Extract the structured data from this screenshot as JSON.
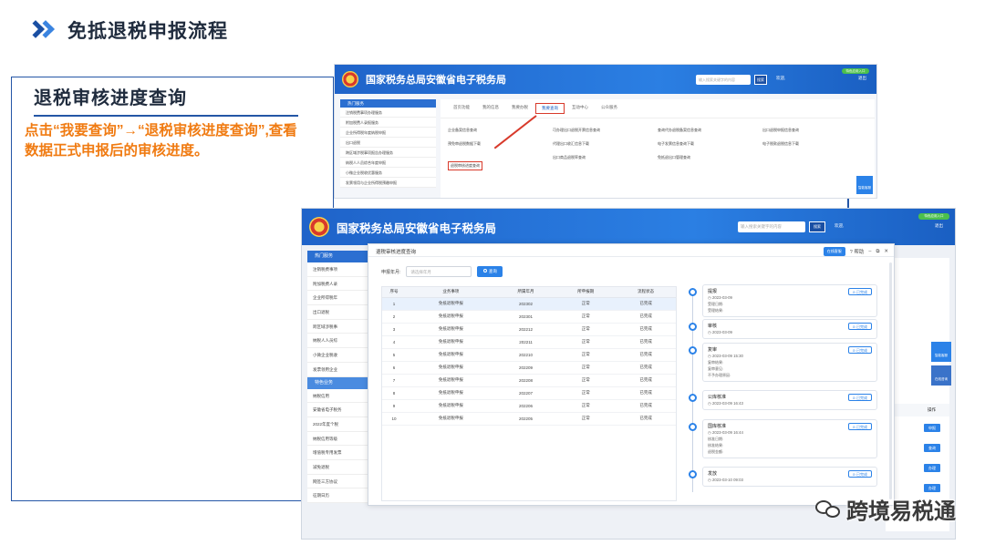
{
  "slide": {
    "title": "免抵退税申报流程",
    "left_title": "退税审核进度查询",
    "left_desc": "点击“我要查询”→“退税审核进度查询”,查看数据正式申报后的审核进度。"
  },
  "portal": {
    "brand": "国家税务总局安徽省电子税务局",
    "search_placeholder": "输入搜索关键字的内容",
    "search_button": "搜索",
    "user_label": "欢迎,",
    "logout": "退出",
    "green_badge": "特色应用入口",
    "sidebar_back": {
      "head": "热门服务",
      "items": [
        "注销税费事项办理服务",
        "附加税费人录报服务",
        "企业所得税年度纳税申报",
        "出口退税",
        "跨区域涉税事项报告办理服务",
        "纳税人人员综合年度申报",
        "小微企业税收优惠服务",
        "发票领用与企业所得税预缴申报"
      ]
    },
    "tabs": [
      "首页功能",
      "我的信息",
      "我要办税",
      "我要查询",
      "互动中心",
      "公众服务"
    ],
    "links": [
      "企业备案信息查询",
      "可办理出口退税开票信息查询",
      "查询代办退税备案信息查询",
      "出口退税申报信息查询",
      "预免审退税数据下载",
      "代理出口收汇信息下载",
      "电子发票信息查询下载",
      "电子税款退税信息下载",
      "退税审核进度查询",
      "出口商品退税率查询",
      "免抵退出口管理查询",
      ""
    ],
    "fab": "智能客服"
  },
  "front": {
    "sidebar": {
      "head": "热门服务",
      "items": [
        "注销税费事项",
        "附加税费人录",
        "企业所得税年",
        "出口退税",
        "跨区域涉税事",
        "纳税人人员综",
        "小微企业税收",
        "发票领用企业"
      ],
      "head2": "特色业务",
      "items2": [
        "纳税信用",
        "安徽省电子税务",
        "2022年度个税",
        "纳税信用等级",
        "增值税专用发票",
        "减免退税",
        "网签三方协议",
        "征期日历"
      ]
    },
    "right_col_header": "操作",
    "right_buttons": [
      "申报",
      "查询",
      "办理",
      "办理"
    ],
    "fabs": [
      "智能客服",
      "在线咨询"
    ]
  },
  "modal": {
    "title": "退税审核进度查询",
    "online_button": "在线客服",
    "help": "帮助",
    "query_label": "申报年月:",
    "query_placeholder": "请选择年月",
    "query_button": "查询",
    "columns": [
      "序号",
      "业务事项",
      "所属年月",
      "所申报期",
      "流程状态"
    ],
    "rows": [
      [
        "1",
        "免抵退税申报",
        "202302",
        "正常",
        "已完成"
      ],
      [
        "2",
        "免抵退税申报",
        "202301",
        "正常",
        "已完成"
      ],
      [
        "3",
        "免抵退税申报",
        "202212",
        "正常",
        "已完成"
      ],
      [
        "4",
        "免抵退税申报",
        "202211",
        "正常",
        "已完成"
      ],
      [
        "5",
        "免抵退税申报",
        "202210",
        "正常",
        "已完成"
      ],
      [
        "6",
        "免抵退税申报",
        "202209",
        "正常",
        "已完成"
      ],
      [
        "7",
        "免抵退税申报",
        "202208",
        "正常",
        "已完成"
      ],
      [
        "8",
        "免抵退税申报",
        "202207",
        "正常",
        "已完成"
      ],
      [
        "9",
        "免抵退税申报",
        "202206",
        "正常",
        "已完成"
      ],
      [
        "10",
        "免抵退税申报",
        "202205",
        "正常",
        "已完成"
      ]
    ],
    "timeline": [
      {
        "name": "提报",
        "time": "2023-03-09",
        "sub": [
          "受理日期:",
          "受理结果:"
        ],
        "badge": "已完成"
      },
      {
        "name": "审核",
        "time": "2023-03-09",
        "sub": [],
        "badge": "已完成"
      },
      {
        "name": "复审",
        "time": "2023-03-09 15:30",
        "sub": [
          "复审结果:",
          "复审意见:",
          "不予办理原因:"
        ],
        "badge": "已完成"
      },
      {
        "name": "公库核准",
        "time": "2023-03-09 16:43",
        "sub": [],
        "badge": "已完成"
      },
      {
        "name": "国库核准",
        "time": "2023-03-09 16:44",
        "sub": [
          "核准日期:",
          "核准结果:",
          "退税金额:"
        ],
        "badge": "已完成"
      },
      {
        "name": "发放",
        "time": "2023-03-10 09:03",
        "sub": [],
        "badge": "已完成"
      }
    ]
  },
  "watermark": "跨境易税通"
}
